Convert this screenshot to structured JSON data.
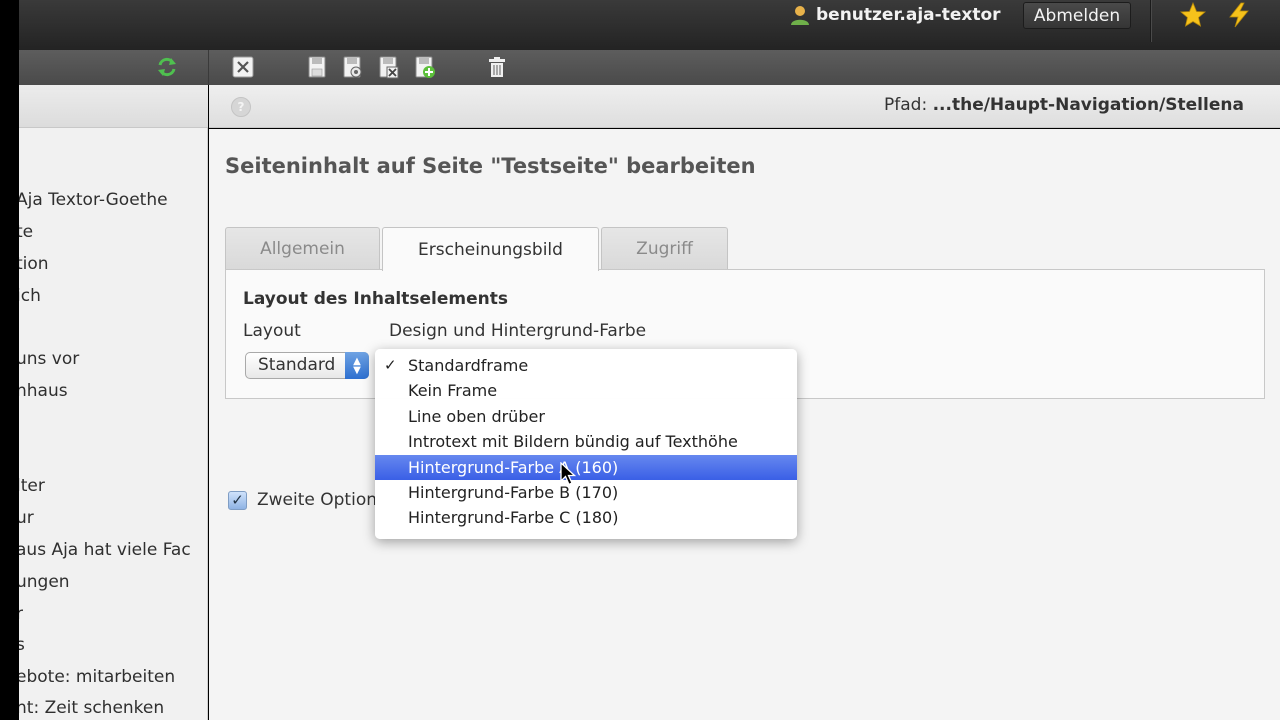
{
  "topbar": {
    "username": "benutzer.aja-textor",
    "logout_label": "Abmelden",
    "colors": {
      "star": "#f6c21b",
      "bolt": "#f6c21b",
      "user_icon": "#e6b54a"
    }
  },
  "toolbar": {
    "icons": [
      "close-icon",
      "save-icon",
      "save-view-icon",
      "save-close-icon",
      "save-new-icon",
      "delete-icon"
    ],
    "refresh_icon": "refresh-icon"
  },
  "docheader": {
    "path_label": "Pfad:",
    "path_value": "...the/Haupt-Navigation/Stellena"
  },
  "tree": {
    "items": [
      "Aja Textor-Goethe",
      "te",
      "tion",
      "ich",
      "uns vor",
      "nhaus",
      "lter",
      "ur",
      "aus Aja hat viele Fac",
      "ungen",
      "r",
      "s",
      "ebote: mitarbeiten",
      "nt: Zeit schenken"
    ]
  },
  "content": {
    "page_title": "Seiteninhalt auf Seite \"Testseite\" bearbeiten",
    "tabs": [
      {
        "label": "Allgemein",
        "active": false
      },
      {
        "label": "Erscheinungsbild",
        "active": true
      },
      {
        "label": "Zugriff",
        "active": false
      }
    ],
    "section_title": "Layout des Inhaltselements",
    "layout_label": "Layout",
    "design_label": "Design und Hintergrund-Farbe",
    "layout_select_value": "Standard",
    "checkbox_label": "Zweite Option",
    "checkbox_checked": true
  },
  "dropdown": {
    "check_glyph": "✓",
    "items": [
      {
        "label": "Standardframe",
        "checked": true,
        "highlighted": false
      },
      {
        "label": "Kein Frame",
        "checked": false,
        "highlighted": false
      },
      {
        "label": "Line oben drüber",
        "checked": false,
        "highlighted": false
      },
      {
        "label": "Introtext mit Bildern bündig auf Texthöhe",
        "checked": false,
        "highlighted": false
      },
      {
        "label": "Hintergrund-Farbe A (160)",
        "checked": false,
        "highlighted": true
      },
      {
        "label": "Hintergrund-Farbe B (170)",
        "checked": false,
        "highlighted": false
      },
      {
        "label": "Hintergrund-Farbe C (180)",
        "checked": false,
        "highlighted": false
      }
    ],
    "highlight_color": "#3a5fe6"
  }
}
